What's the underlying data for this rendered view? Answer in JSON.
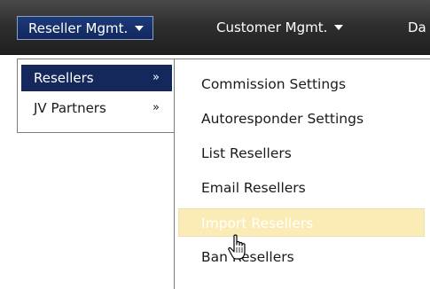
{
  "menubar": {
    "items": [
      {
        "label": "Reseller Mgmt."
      },
      {
        "label": "Customer Mgmt."
      },
      {
        "label": "Da"
      }
    ]
  },
  "dropdown": {
    "items": [
      {
        "label": "Resellers",
        "arrow": "»"
      },
      {
        "label": "JV Partners",
        "arrow": "»"
      }
    ]
  },
  "submenu": {
    "items": [
      {
        "label": "Commission Settings"
      },
      {
        "label": "Autoresponder Settings"
      },
      {
        "label": "List Resellers"
      },
      {
        "label": "Email Resellers"
      },
      {
        "label": "Import Resellers"
      },
      {
        "label": "Ban Resellers"
      }
    ]
  },
  "colors": {
    "menubar": "#2f2f2f",
    "active": "#15285c",
    "hover": "#fbecb5"
  },
  "cursor": {
    "icon": "hand-pointer-icon"
  }
}
